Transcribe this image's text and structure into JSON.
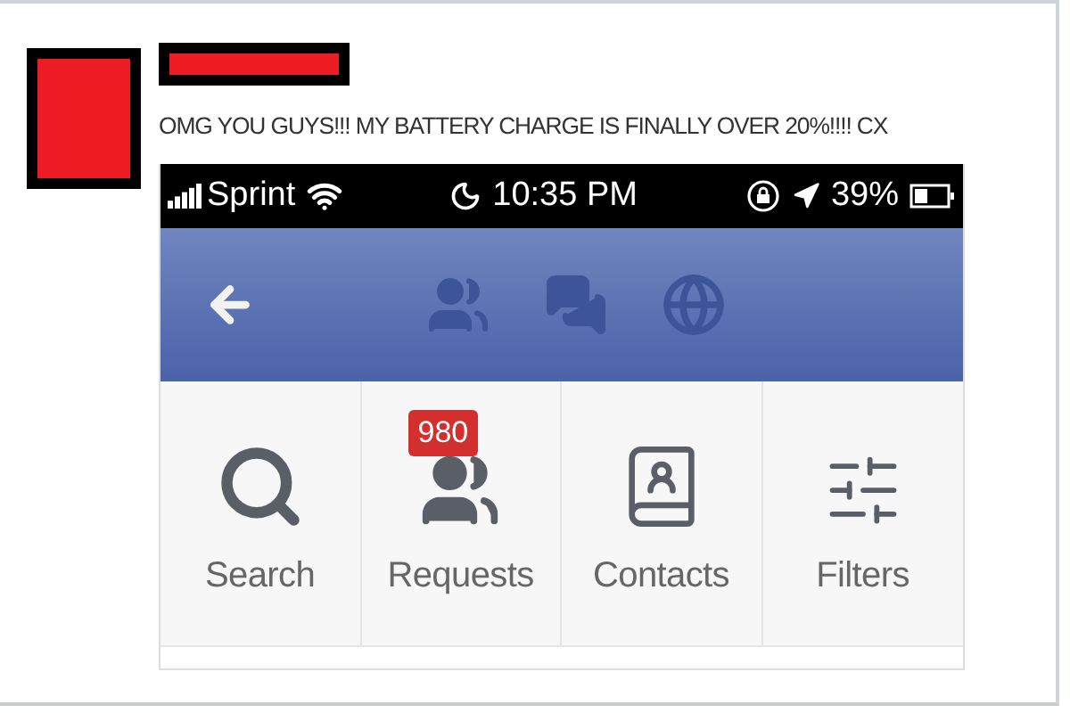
{
  "post": {
    "message": "OMG YOU GUYS!!! MY BATTERY CHARGE IS FINALLY OVER 20%!!!! CX"
  },
  "status_bar": {
    "carrier": "Sprint",
    "time": "10:35 PM",
    "battery": "39%"
  },
  "shortcuts": [
    {
      "kind": "search",
      "label": "Search"
    },
    {
      "kind": "requests",
      "label": "Requests",
      "badge": "980"
    },
    {
      "kind": "contacts",
      "label": "Contacts"
    },
    {
      "kind": "filters",
      "label": "Filters"
    }
  ]
}
